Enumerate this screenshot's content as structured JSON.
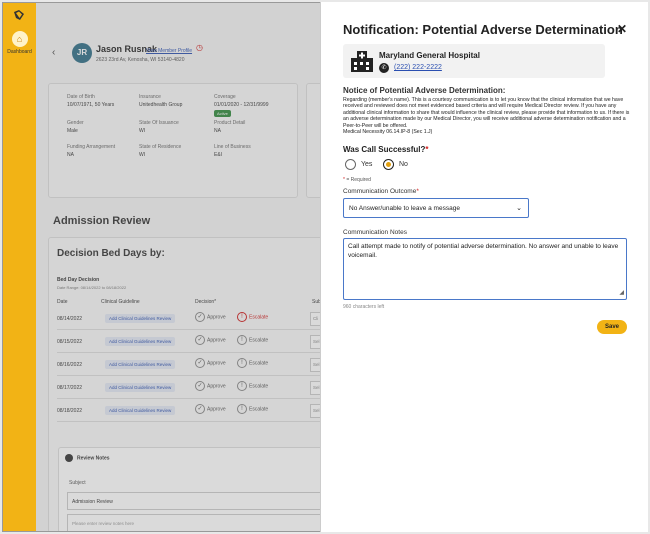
{
  "sidebar": {
    "dashboard_label": "Dashboard"
  },
  "patient": {
    "initials": "JR",
    "name": "Jason Rusnak",
    "view_profile_link": "View Member Profile",
    "address": "2623 23rd Av, Kenosha, WI 53140-4820"
  },
  "member_info": {
    "dob_label": "Date of Birth",
    "dob_value": "10/07/1971, 50 Years",
    "insurance_label": "Insurance",
    "insurance_value": "Unitedhealth Group",
    "coverage_label": "Coverage",
    "coverage_value": "01/01/2020 - 12/31/9999",
    "coverage_status": "Active",
    "gender_label": "Gender",
    "gender_value": "Male",
    "state_issuance_label": "State Of Issuance",
    "state_issuance_value": "WI",
    "product_label": "Product Detail",
    "product_value": "NA",
    "funding_label": "Funding Arrangement",
    "funding_value": "NA",
    "residence_label": "State of Residence",
    "residence_value": "WI",
    "lob_label": "Line of Business",
    "lob_value": "E&I"
  },
  "admission_review": {
    "title": "Admission Review",
    "card_title": "Decision Bed Days by:",
    "bed_day_decision": "Bed Day Decision",
    "date_range": "Date Range: 08/14/2022 to 08/18/2022",
    "columns": {
      "date": "Date",
      "guideline": "Clinical Guideline",
      "decision": "Decision*",
      "sub": "Subt"
    },
    "rows": [
      {
        "date": "08/14/2022",
        "guideline": "Add Clinical Guidelines Review",
        "approve": "Approve",
        "escalate": "Escalate",
        "escalated": true,
        "sub": "Cli"
      },
      {
        "date": "08/15/2022",
        "guideline": "Add Clinical Guidelines Review",
        "approve": "Approve",
        "escalate": "Escalate",
        "escalated": false,
        "sub": "Sel"
      },
      {
        "date": "08/16/2022",
        "guideline": "Add Clinical Guidelines Review",
        "approve": "Approve",
        "escalate": "Escalate",
        "escalated": false,
        "sub": "Sel"
      },
      {
        "date": "08/17/2022",
        "guideline": "Add Clinical Guidelines Review",
        "approve": "Approve",
        "escalate": "Escalate",
        "escalated": false,
        "sub": "Sel"
      },
      {
        "date": "08/18/2022",
        "guideline": "Add Clinical Guidelines Review",
        "approve": "Approve",
        "escalate": "Escalate",
        "escalated": false,
        "sub": "Sel"
      }
    ],
    "review_notes": {
      "title": "Review Notes",
      "subject_label": "Subject",
      "subject_value": "Admission Review",
      "notes_placeholder": "Please enter review notes here"
    }
  },
  "modal": {
    "title": "Notification: Potential Adverse Determination",
    "hospital_name": "Maryland General Hospital",
    "hospital_phone": "(222) 222-2222",
    "notice_heading": "Notice of Potential Adverse Determination:",
    "notice_body": "Regarding (member's name). This is a courtesy communication is to let you know that the clinical information that we have received and reviewed does not meet evidenced based criteria and will require Medical Director review. If you have any additional clinical information to share that would influence the clinical review, please provide that information to us. If there is an adverse determination made by our Medical Director, you will receive additional adverse determination notification and a Peer-to-Peer will be offered.",
    "notice_footer": "Medical Necessity 06.14.IP-8 (Sec 1.J)",
    "question_label": "Was Call Successful?",
    "required_star": "*",
    "yes_label": "Yes",
    "no_label": "No",
    "selected": "No",
    "required_note": "* = Required",
    "outcome_label": "Communication Outcome",
    "outcome_value": "No Answer/unable to leave a message",
    "notes_label": "Communication Notes",
    "notes_value": "Call attempt made to notify of potential adverse determination. No answer and unable to leave voicemail.",
    "chars_left": "960 characters left",
    "save_label": "Save"
  },
  "colors": {
    "accent": "#f2b315",
    "link": "#2a4fb0",
    "escalate": "#d01b1b",
    "focus_border": "#4a78c9"
  }
}
